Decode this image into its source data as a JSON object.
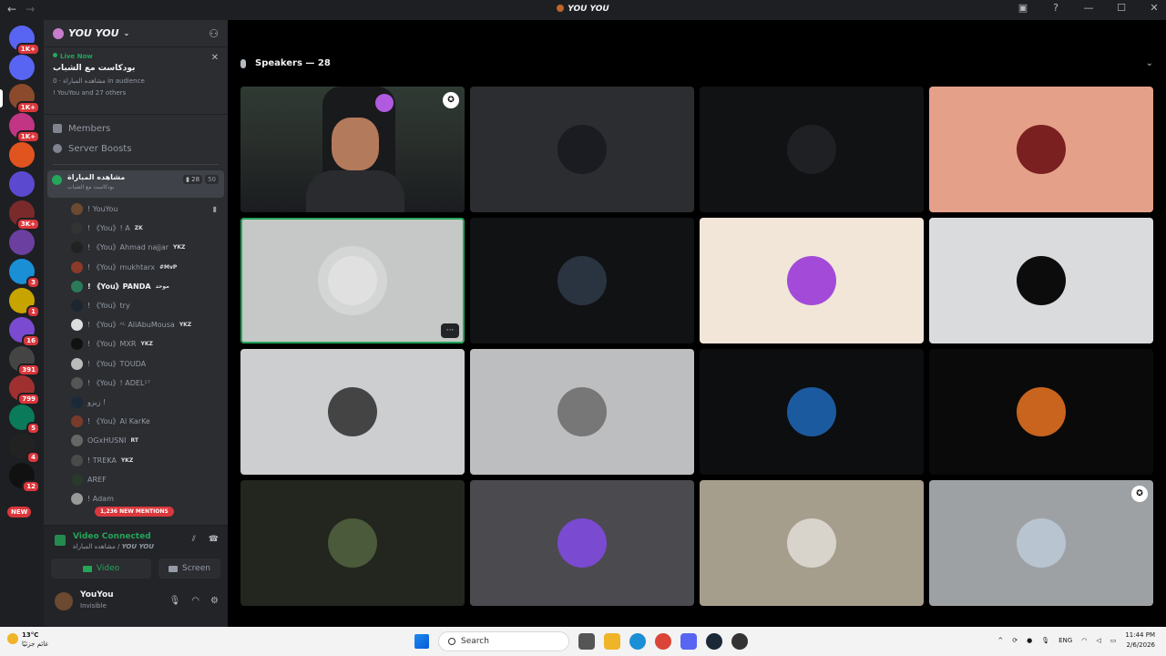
{
  "window": {
    "title": "YOU YOU",
    "nav": [
      "←",
      "→"
    ]
  },
  "guilds": [
    {
      "badge": "1K+",
      "color": "#5865f2"
    },
    {
      "badge": "",
      "color": "#5865f2"
    },
    {
      "badge": "1K+",
      "color": "#8b4a2b"
    },
    {
      "badge": "1K+",
      "color": "#c13584"
    },
    {
      "badge": "",
      "color": "#e2541f"
    },
    {
      "badge": "",
      "color": "#5b4ad0"
    },
    {
      "badge": "3K+",
      "color": "#7a2a2a"
    },
    {
      "badge": "",
      "color": "#6b3fa0"
    },
    {
      "badge": "3",
      "color": "#1a8fd6"
    },
    {
      "badge": "1",
      "color": "#c8a400"
    },
    {
      "badge": "16",
      "color": "#7a4ad0"
    },
    {
      "badge": "391",
      "color": "#444"
    },
    {
      "badge": "799",
      "color": "#a03030"
    },
    {
      "badge": "5",
      "color": "#0a7a5a"
    },
    {
      "badge": "4",
      "color": "#222"
    },
    {
      "badge": "12",
      "color": "#111"
    }
  ],
  "new_label": "NEW",
  "server": {
    "name": "YOU YOU",
    "live_label": "Live Now",
    "live_title": "بودكاست مع الشباب",
    "live_meta_channel": "مشاهده المباراة",
    "live_meta_audience": "0 in audience",
    "live_participants": "! YouYou and 27 others",
    "members_label": "Members",
    "boosts_label": "Server Boosts"
  },
  "voice_channel": {
    "name": "مشاهده المباراة",
    "subtitle": "بودكاست مع الشباب",
    "video_count": "28",
    "limit": "50"
  },
  "members": [
    {
      "name": "! YouYou",
      "tag": "",
      "color": "#6b4a2f",
      "cam": true
    },
    {
      "name": "! 《You》! A",
      "tag": "ZK",
      "color": "#333",
      "cam": false
    },
    {
      "name": "! 《You》Ahmad najjar",
      "tag": "YKZ",
      "color": "#222",
      "cam": false
    },
    {
      "name": "! 《You》mukhtarx",
      "tag": "#MvP",
      "color": "#8b3a2a",
      "cam": false
    },
    {
      "name": "! 《You》PANDA",
      "tag": "موحد",
      "color": "#2a7a5a",
      "cam": false,
      "highlight": true
    },
    {
      "name": "! 《You》try",
      "tag": "",
      "color": "#1c2630",
      "cam": false
    },
    {
      "name": "! 《You》ᴬᴸ AliAbuMousa",
      "tag": "YKZ",
      "color": "#ddd",
      "cam": false
    },
    {
      "name": "! 《You》MXR",
      "tag": "YKZ",
      "color": "#111",
      "cam": false
    },
    {
      "name": "! 《You》TOUDA",
      "tag": "",
      "color": "#bbb",
      "cam": false
    },
    {
      "name": "! 《You》! ADEL¹⁷",
      "tag": "",
      "color": "#555",
      "cam": false
    },
    {
      "name": "زيزو !",
      "tag": "",
      "color": "#1a2a3a",
      "cam": false
    },
    {
      "name": "! 《You》Al KarKe",
      "tag": "",
      "color": "#7a3a2a",
      "cam": false
    },
    {
      "name": "OGxHUSNI",
      "tag": "RT",
      "color": "#666",
      "cam": false
    },
    {
      "name": "! TREKA",
      "tag": "YKZ",
      "color": "#4a4a4a",
      "cam": false
    },
    {
      "name": "AREF",
      "tag": "",
      "color": "#2a3a2a",
      "cam": false
    },
    {
      "name": "! Adam",
      "tag": "",
      "color": "#999",
      "cam": false
    }
  ],
  "mentions_label": "1,236 NEW MENTIONS",
  "voice_panel": {
    "status": "Video Connected",
    "location_channel": "مشاهده المباراة",
    "location_server": "YOU YOU",
    "video_label": "Video",
    "screen_label": "Screen"
  },
  "user": {
    "name": "YouYou",
    "status": "Invisible"
  },
  "stage": {
    "header": "Speakers — 28"
  },
  "tiles": [
    {
      "bg": "#2a302c",
      "avatar": "",
      "camera": true,
      "badge": true
    },
    {
      "bg": "#2b2d31",
      "avatar": "#1b1b22"
    },
    {
      "bg": "#111214",
      "avatar": "#1e2024"
    },
    {
      "bg": "#e5a08a",
      "avatar": "#7a2020"
    },
    {
      "bg": "#c6c8c7",
      "avatar": "#e0e0e0",
      "active": true,
      "more": true
    },
    {
      "bg": "#111214",
      "avatar": "#2a3440"
    },
    {
      "bg": "#f1e6d8",
      "avatar": "#a34ad8"
    },
    {
      "bg": "#dadbdc",
      "avatar": "#0c0c0c"
    },
    {
      "bg": "#ccced0",
      "avatar": "#444"
    },
    {
      "bg": "#bdbec0",
      "avatar": "#777"
    },
    {
      "bg": "#0d0e10",
      "avatar": "#1c5aa0"
    },
    {
      "bg": "#0a0a0a",
      "avatar": "#c8641e"
    },
    {
      "bg": "#22261f",
      "avatar": "#4a5a3a"
    },
    {
      "bg": "#4a4a4f",
      "avatar": "#7a4ad0"
    },
    {
      "bg": "#a69e8c",
      "avatar": "#d8d4cc"
    },
    {
      "bg": "#9ea1a3",
      "avatar": "#b8c4d0",
      "badge": true
    }
  ],
  "taskbar": {
    "temperature": "13°C",
    "weather_desc": "غائم جزئيًا",
    "search_placeholder": "Search",
    "lang": "ENG",
    "time": "11:44 PM",
    "date": "2/6/2026"
  }
}
